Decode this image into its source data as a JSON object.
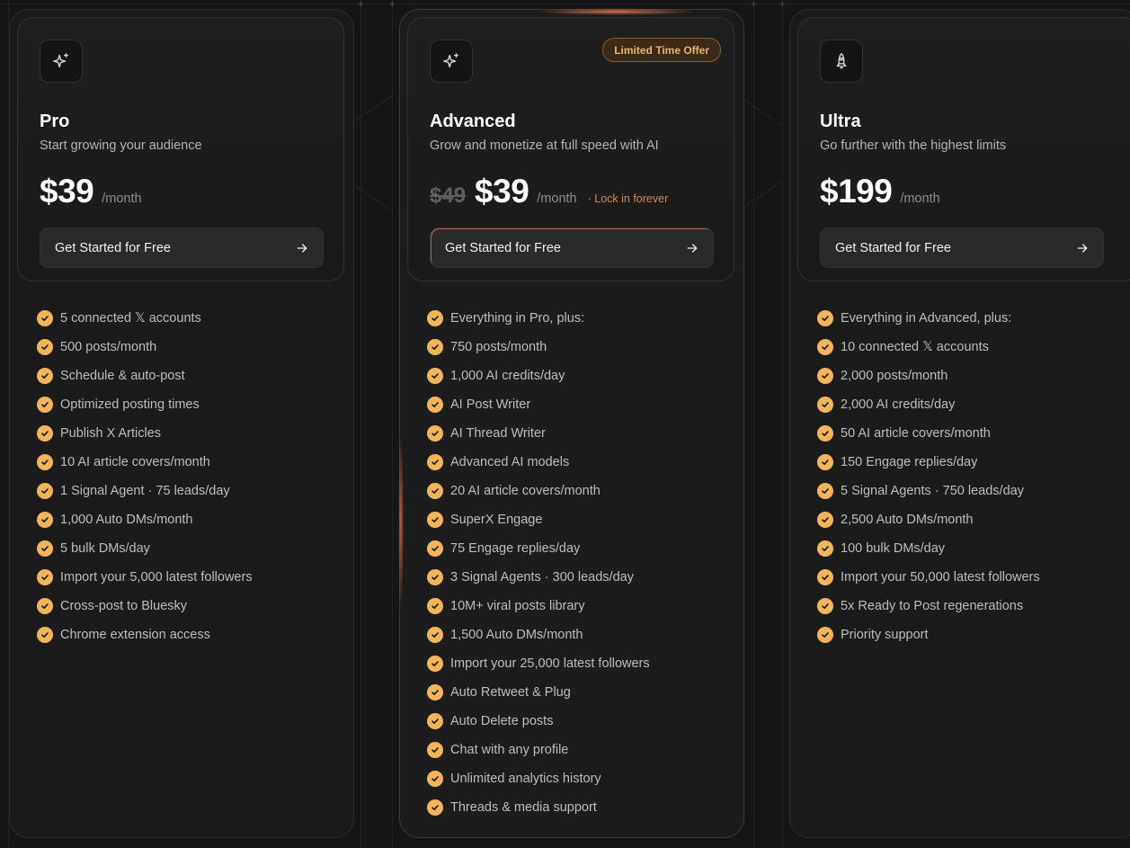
{
  "colors": {
    "background": "#161616",
    "accent": "#f3b55c",
    "badge_text": "#f0b068",
    "glow": "#e16946"
  },
  "plans": [
    {
      "icon": "sparkle-icon",
      "name": "Pro",
      "description": "Start growing your audience",
      "old_price": "",
      "price": "$39",
      "period": "/month",
      "note": "",
      "badge": "",
      "cta": "Get Started for Free",
      "features": [
        "5 connected 𝕏 accounts",
        "500 posts/month",
        "Schedule & auto-post",
        "Optimized posting times",
        "Publish X Articles",
        "10 AI article covers/month",
        "1 Signal Agent · 75 leads/day",
        "1,000 Auto DMs/month",
        "5 bulk DMs/day",
        "Import your 5,000 latest followers",
        "Cross-post to Bluesky",
        "Chrome extension access"
      ]
    },
    {
      "icon": "sparkle-icon",
      "name": "Advanced",
      "description": "Grow and monetize at full speed with AI",
      "old_price": "$49",
      "price": "$39",
      "period": "/month",
      "note": "· Lock in forever",
      "badge": "Limited Time Offer",
      "cta": "Get Started for Free",
      "features": [
        "Everything in Pro, plus:",
        "750 posts/month",
        "1,000 AI credits/day",
        "AI Post Writer",
        "AI Thread Writer",
        "Advanced AI models",
        "20 AI article covers/month",
        "SuperX Engage",
        "75 Engage replies/day",
        "3 Signal Agents · 300 leads/day",
        "10M+ viral posts library",
        "1,500 Auto DMs/month",
        "Import your 25,000 latest followers",
        "Auto Retweet & Plug",
        "Auto Delete posts",
        "Chat with any profile",
        "Unlimited analytics history",
        "Threads & media support"
      ]
    },
    {
      "icon": "rocket-icon",
      "name": "Ultra",
      "description": "Go further with the highest limits",
      "old_price": "",
      "price": "$199",
      "period": "/month",
      "note": "",
      "badge": "",
      "cta": "Get Started for Free",
      "features": [
        "Everything in Advanced, plus:",
        "10 connected 𝕏 accounts",
        "2,000 posts/month",
        "2,000 AI credits/day",
        "50 AI article covers/month",
        "150 Engage replies/day",
        "5 Signal Agents · 750 leads/day",
        "2,500 Auto DMs/month",
        "100 bulk DMs/day",
        "Import your 50,000 latest followers",
        "5x Ready to Post regenerations",
        "Priority support"
      ]
    }
  ]
}
